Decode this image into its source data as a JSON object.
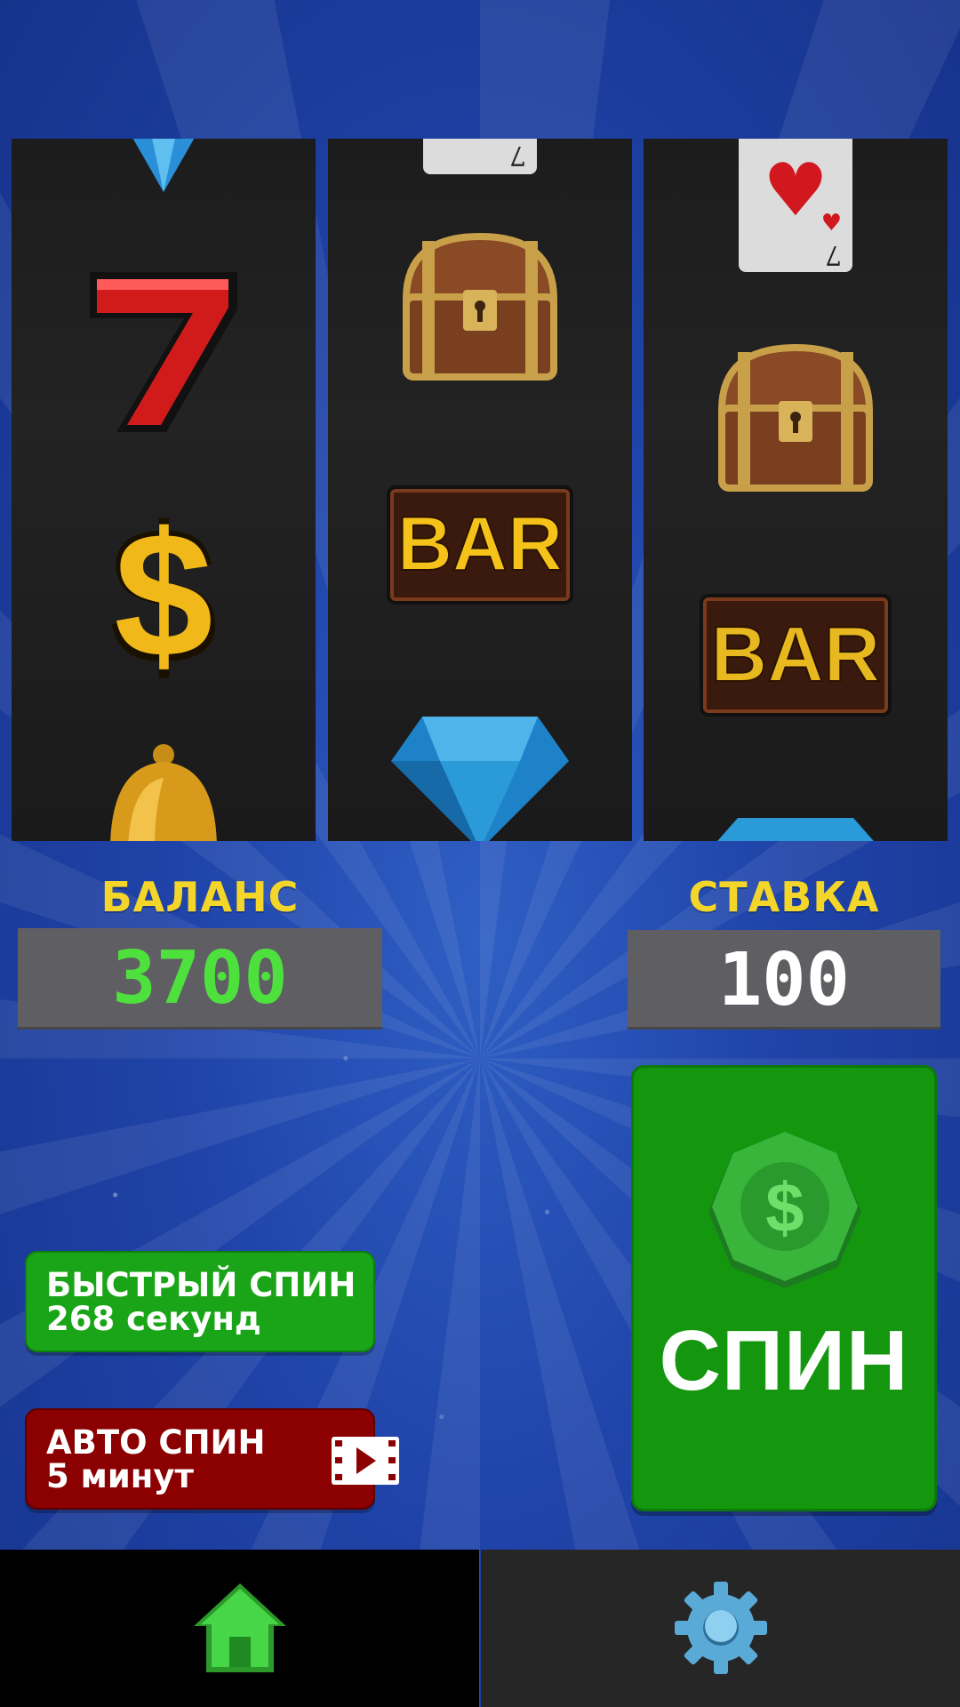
{
  "reels": [
    {
      "symbols": [
        "diamond",
        "seven",
        "dollar",
        "bell"
      ]
    },
    {
      "symbols": [
        "card-7",
        "treasure-chest",
        "bar",
        "diamond"
      ]
    },
    {
      "symbols": [
        "card-7-hearts",
        "treasure-chest",
        "bar",
        "diamond"
      ]
    }
  ],
  "bar_text": "BAR",
  "balance": {
    "label": "БАЛАНС",
    "value": "3700",
    "value_color": "#4ee13e"
  },
  "bet": {
    "label": "СТАВКА",
    "value": "100",
    "value_color": "#ffffff"
  },
  "quick_spin": {
    "line1": "БЫСТРЫЙ СПИН",
    "line2": "268 секунд",
    "color": "#1aa518"
  },
  "auto_spin": {
    "line1": "АВТО СПИН",
    "line2": "5 минут",
    "color": "#8b0000",
    "icon": "video-icon"
  },
  "spin_button": {
    "label": "СПИН",
    "icon": "dollar-coin-icon",
    "color": "#14960f"
  },
  "card_rank": "7",
  "tabs": [
    {
      "name": "home",
      "icon": "home-icon",
      "active": true
    },
    {
      "name": "settings",
      "icon": "gear-icon",
      "active": false
    }
  ]
}
